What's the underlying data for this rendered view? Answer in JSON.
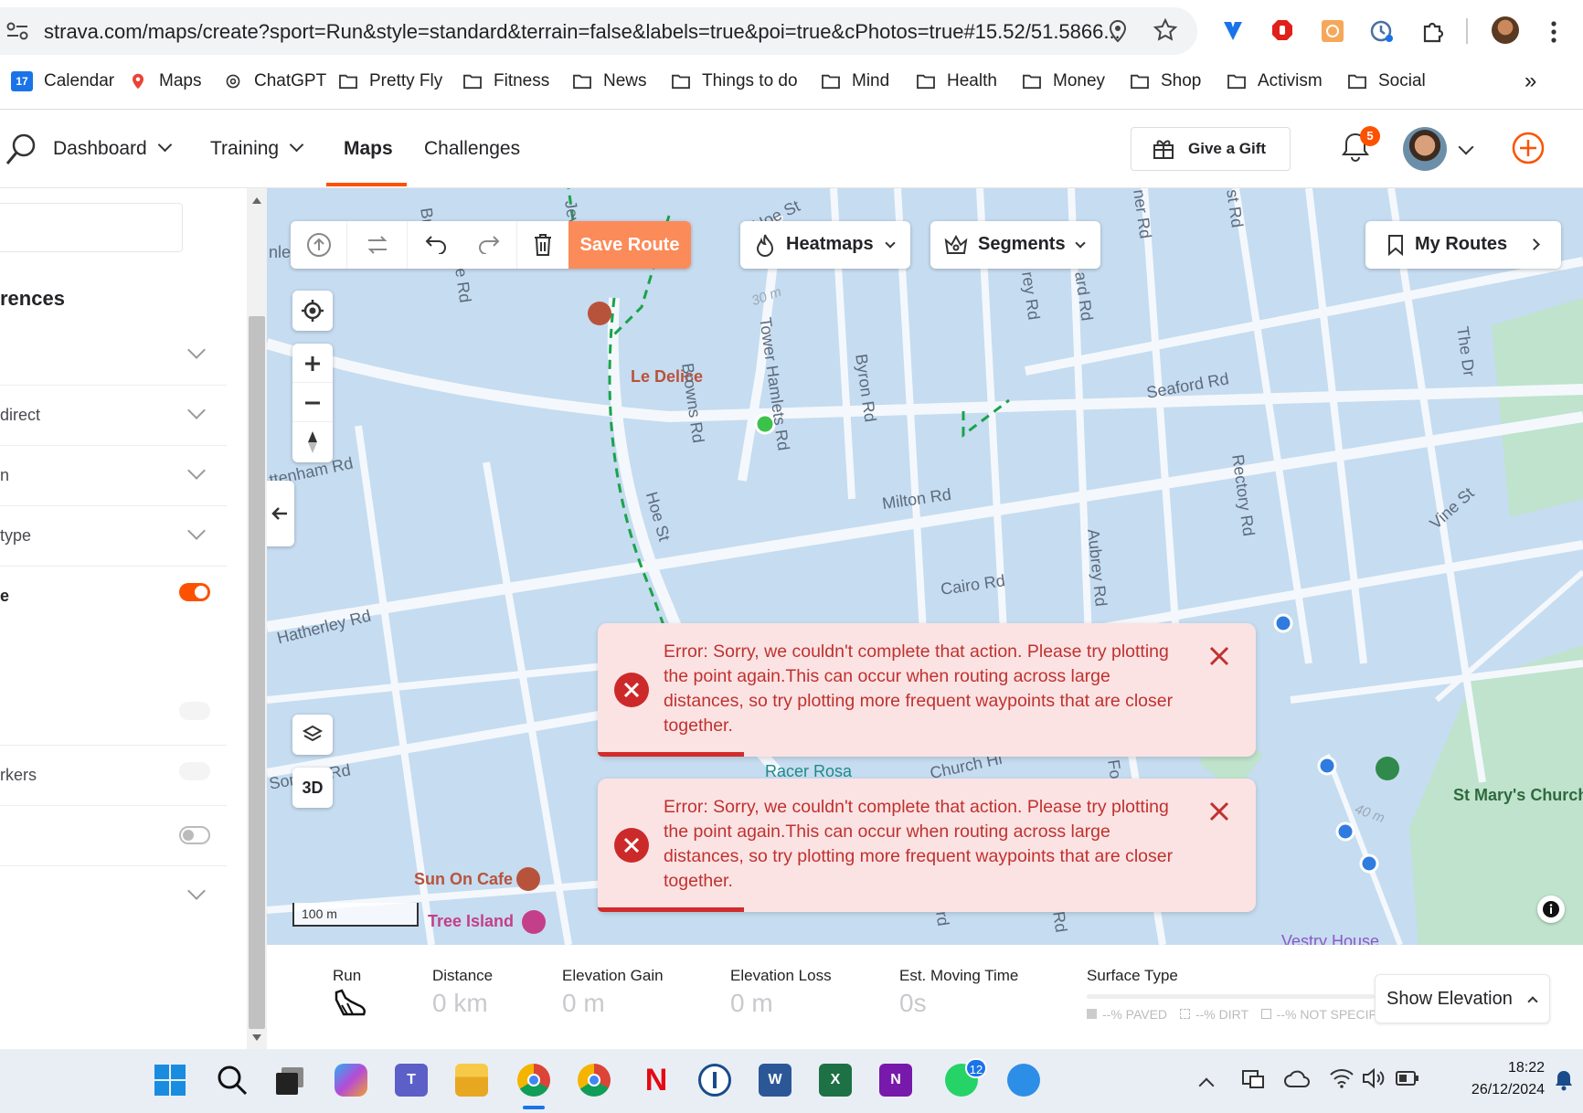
{
  "browser": {
    "url": "strava.com/maps/create?sport=Run&style=standard&terrain=false&labels=true&poi=true&cPhotos=true#15.52/51.5866...",
    "bookmarks": [
      "Calendar",
      "Maps",
      "ChatGPT",
      "Pretty Fly",
      "Fitness",
      "News",
      "Things to do",
      "Mind",
      "Health",
      "Money",
      "Shop",
      "Activism",
      "Social"
    ],
    "calendar_icon_day": "17",
    "more_label": "»"
  },
  "header": {
    "nav": [
      "Dashboard",
      "Training",
      "Maps",
      "Challenges"
    ],
    "active": "Maps",
    "gift_label": "Give a Gift",
    "notification_count": "5",
    "accent": "#fc5200"
  },
  "sidebar": {
    "heading": "rences",
    "rows": [
      "",
      "direct",
      "n",
      "type",
      "e",
      "",
      "",
      "rkers",
      "",
      ""
    ],
    "toggle_on": true
  },
  "map": {
    "toolbar": {
      "save_label": "Save Route",
      "heatmaps_label": "Heatmaps",
      "segments_label": "Segments",
      "my_routes_label": "My Routes"
    },
    "three_d_label": "3D",
    "scale_label": "100 m",
    "labels": {
      "le_delice": "Le Delice",
      "tower_hamlets": "Tower Hamlets Rd",
      "browns": "Browns Rd",
      "byron": "Byron Rd",
      "seaford": "Seaford Rd",
      "rectory": "Rectory Rd",
      "the_dr": "The Dr",
      "vine": "Vine St",
      "milton": "Milton Rd",
      "hoe": "Hoe St",
      "cairo": "Cairo Rd",
      "aubrey": "Aubrey Rd",
      "hatherley": "Hatherley Rd",
      "somers": "Somers Rd",
      "ttenham": "ttenham Rd",
      "racer_rosa": "Racer Rosa",
      "church": "Church Hi",
      "st_marys": "St Mary's Church",
      "sun_on_cafe": "Sun On Cafe",
      "tree_island": "Tree Island",
      "vestry": "Vestry House",
      "elev30": "30 m",
      "elev40": "40 m",
      "hoe_st_top": "Hoe St",
      "ner_rd": "ner Rd",
      "st_rd": "st Rd",
      "rey_rd": "rey Rd",
      "ard_rd": "ard Rd",
      "br": "Br",
      "e_rd": "e Rd",
      "jev": "Jev",
      "nlea": "nlea",
      "fo": "Fo",
      "rd1": "rd",
      "rd2": "Rd"
    },
    "errors": [
      {
        "text": "Error: Sorry, we couldn't complete that action. Please try plotting the point again.This can occur when routing across large distances, so try plotting more frequent waypoints that are closer together."
      },
      {
        "text": "Error: Sorry, we couldn't complete that action. Please try plotting the point again.This can occur when routing across large distances, so try plotting more frequent waypoints that are closer together."
      }
    ]
  },
  "stats": {
    "sport_label": "Run",
    "distance_label": "Distance",
    "distance_value": "0 km",
    "gain_label": "Elevation Gain",
    "gain_value": "0 m",
    "loss_label": "Elevation Loss",
    "loss_value": "0 m",
    "time_label": "Est. Moving Time",
    "time_value": "0s",
    "surface_label": "Surface Type",
    "surface_paved": "--% PAVED",
    "surface_dirt": "--% DIRT",
    "surface_unspec": "--% NOT SPECIF",
    "show_elevation_label": "Show Elevation"
  },
  "taskbar": {
    "time": "18:22",
    "date": "26/12/2024",
    "whatsapp_badge": "12"
  }
}
